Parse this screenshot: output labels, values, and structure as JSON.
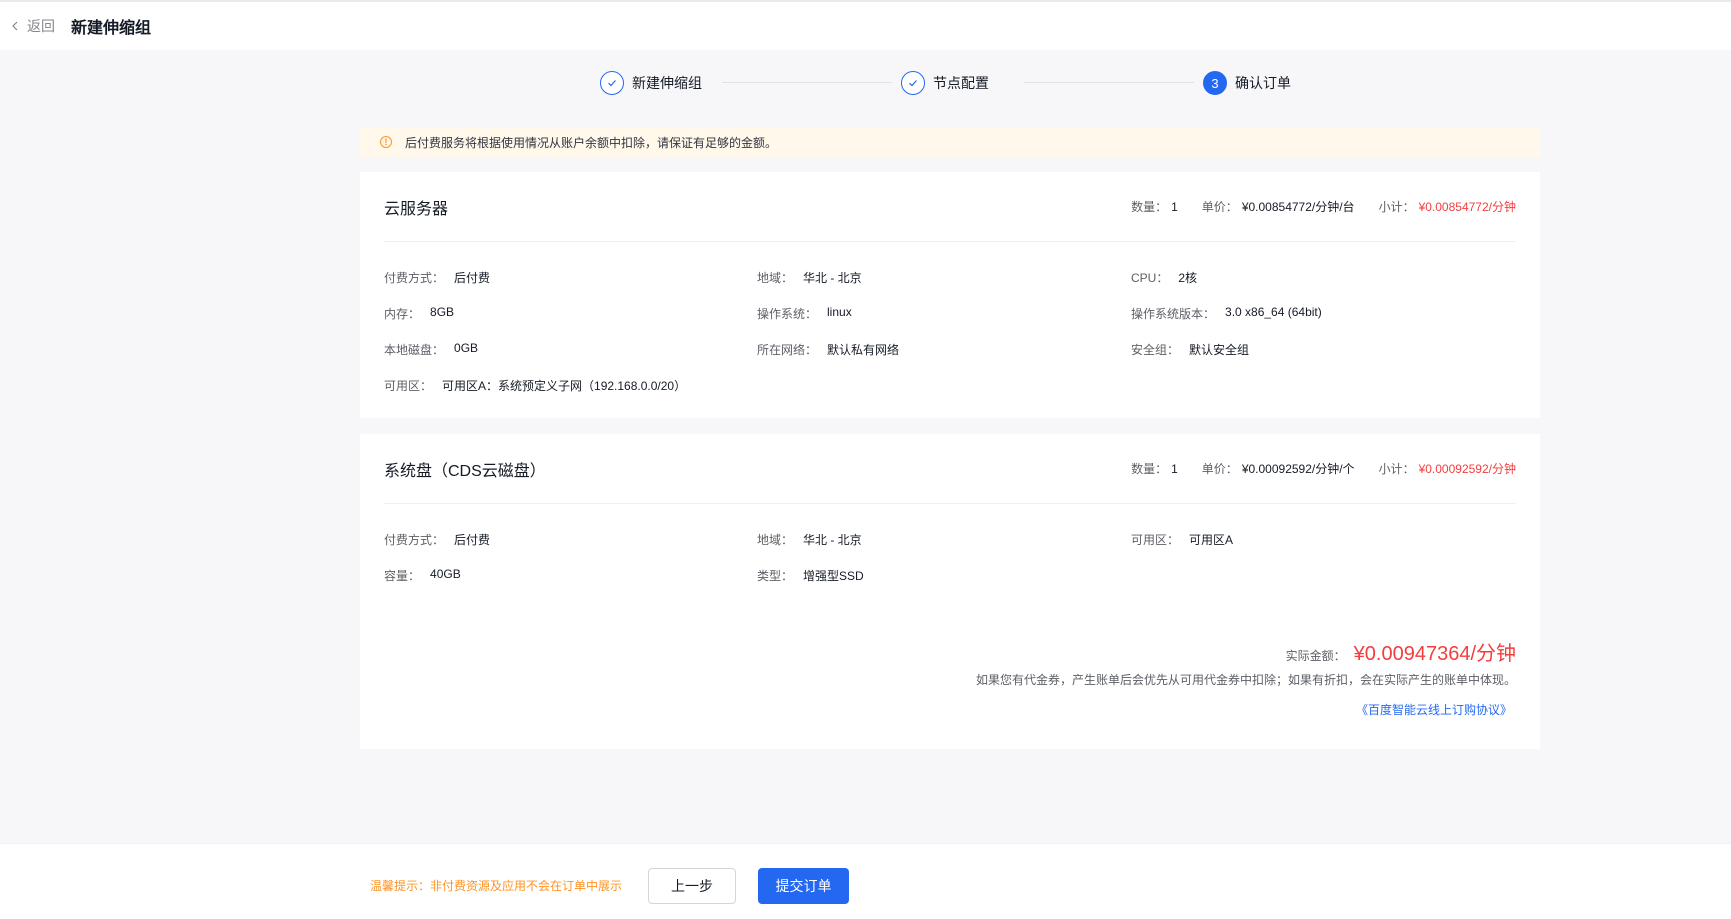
{
  "header": {
    "back_label": "返回",
    "title": "新建伸缩组"
  },
  "steps": [
    {
      "label": "新建伸缩组",
      "status": "done"
    },
    {
      "label": "节点配置",
      "status": "done"
    },
    {
      "label": "确认订单",
      "status": "active",
      "number": "3"
    }
  ],
  "notice": {
    "text": "后付费服务将根据使用情况从账户余额中扣除，请保证有足够的金额。"
  },
  "server_card": {
    "title": "云服务器",
    "qty_label": "数量：",
    "qty": "1",
    "unit_label": "单价：",
    "unit": "¥0.00854772/分钟/台",
    "subtotal_label": "小计：",
    "subtotal": "¥0.00854772/分钟",
    "items": [
      {
        "k": "付费方式：",
        "v": "后付费"
      },
      {
        "k": "地域：",
        "v": "华北 - 北京"
      },
      {
        "k": "CPU：",
        "v": "2核"
      },
      {
        "k": "内存：",
        "v": "8GB"
      },
      {
        "k": "操作系统：",
        "v": "linux"
      },
      {
        "k": "操作系统版本：",
        "v": "3.0 x86_64 (64bit)"
      },
      {
        "k": "本地磁盘：",
        "v": "0GB"
      },
      {
        "k": "所在网络：",
        "v": "默认私有网络"
      },
      {
        "k": "安全组：",
        "v": "默认安全组"
      },
      {
        "k": "可用区：",
        "v": "可用区A：系统预定义子网（192.168.0.0/20）"
      }
    ]
  },
  "disk_card": {
    "title": "系统盘（CDS云磁盘）",
    "qty_label": "数量：",
    "qty": "1",
    "unit_label": "单价：",
    "unit": "¥0.00092592/分钟/个",
    "subtotal_label": "小计：",
    "subtotal": "¥0.00092592/分钟",
    "items": [
      {
        "k": "付费方式：",
        "v": "后付费"
      },
      {
        "k": "地域：",
        "v": "华北 - 北京"
      },
      {
        "k": "可用区：",
        "v": "可用区A"
      },
      {
        "k": "容量：",
        "v": "40GB"
      },
      {
        "k": "类型：",
        "v": "增强型SSD"
      }
    ]
  },
  "summary": {
    "total_label": "实际金额：",
    "total_value": "¥0.00947364/分钟",
    "note": "如果您有代金券，产生账单后会优先从可用代金券中扣除；如果有折扣，会在实际产生的账单中体现。",
    "agreement": "《百度智能云线上订购协议》"
  },
  "footer": {
    "tip": "温馨提示：非付费资源及应用不会在订单中展示",
    "prev_label": "上一步",
    "submit_label": "提交订单"
  },
  "colors": {
    "accent": "#2468f2",
    "price": "#f33e3e",
    "warning": "#ff9326"
  }
}
